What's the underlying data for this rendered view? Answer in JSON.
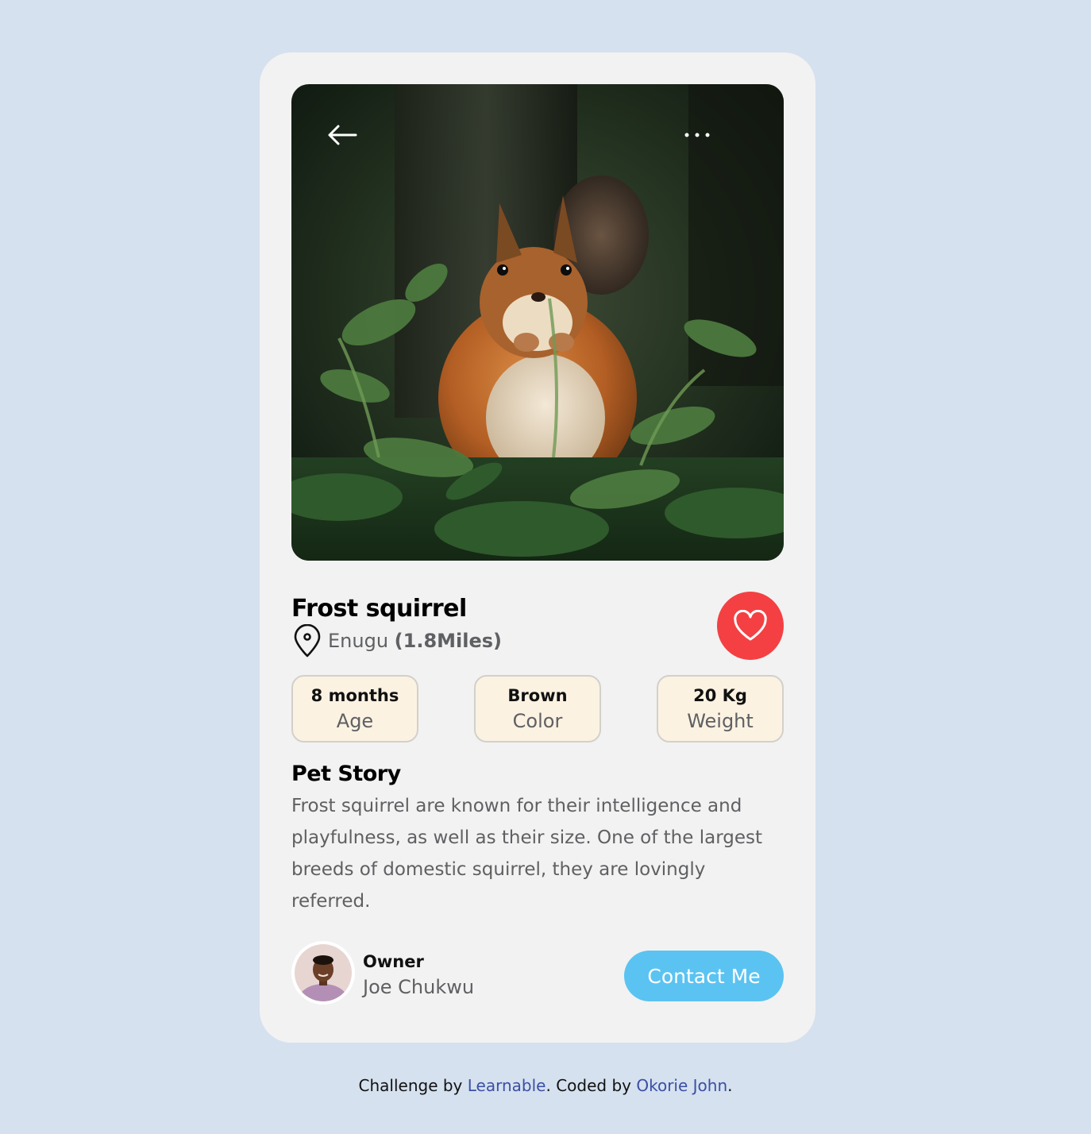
{
  "pet": {
    "name": "Frost squirrel",
    "location": "Enugu",
    "distance": "(1.8Miles)"
  },
  "stats": [
    {
      "value": "8 months",
      "label": "Age"
    },
    {
      "value": "Brown",
      "label": "Color"
    },
    {
      "value": "20 Kg",
      "label": "Weight"
    }
  ],
  "story": {
    "title": "Pet Story",
    "text": "Frost squirrel are known for their intelligence and playfulness, as well as their size. One of the largest breeds of domestic squirrel, they are lovingly referred."
  },
  "owner": {
    "label": "Owner",
    "name": "Joe Chukwu"
  },
  "contact_label": "Contact Me",
  "footer": {
    "prefix": "Challenge by ",
    "link1": "Learnable",
    "middle": ". Coded by ",
    "link2": "Okorie John",
    "suffix": "."
  },
  "icons": {
    "back": "arrow-left-icon",
    "more": "more-dots-icon",
    "location": "map-pin-icon",
    "favorite": "heart-icon"
  },
  "colors": {
    "background": "#d5e1ef",
    "card": "#f2f2f2",
    "heart_button": "#f44043",
    "stat_fill": "#fcf2e2",
    "contact_button": "#5bc3f1",
    "link": "#3b4fa4"
  }
}
